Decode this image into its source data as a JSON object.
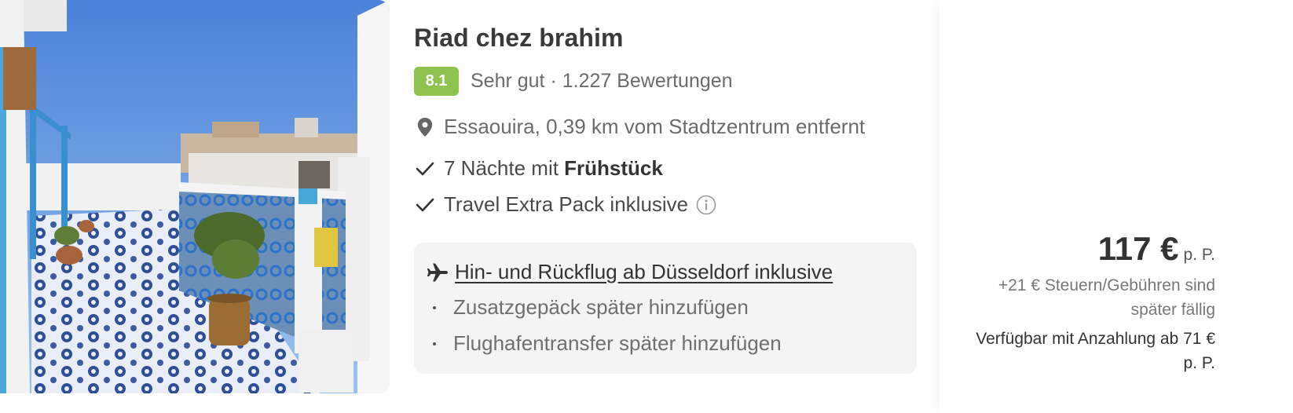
{
  "hotel": {
    "name": "Riad chez brahim",
    "score": "8.1",
    "rating_text": "Sehr gut · 1.227 Bewertungen",
    "location": "Essaouira, 0,39 km vom Stadtzentrum entfernt",
    "photo_alt": "Dachterrasse mit blauen Fliesen",
    "score_color": "#8fc34f"
  },
  "features": {
    "nights_prefix": "7 Nächte mit ",
    "nights_board": "Frühstück",
    "pack": "Travel Extra Pack inklusive"
  },
  "flight": {
    "main": "Hin- und Rückflug ab Düsseldorf inklusive",
    "addons": [
      "Zusatzgepäck später hinzufügen",
      "Flughafentransfer später hinzufügen"
    ]
  },
  "price": {
    "amount": "117 €",
    "unit": "p. P.",
    "taxes_note": "+21 € Steuern/Gebühren sind später fällig",
    "deposit_note": "Verfügbar mit Anzahlung ab 71 € p. P."
  },
  "icons": {
    "location": "map-pin-icon",
    "check": "check-icon",
    "info": "info-icon",
    "plane": "plane-icon"
  }
}
